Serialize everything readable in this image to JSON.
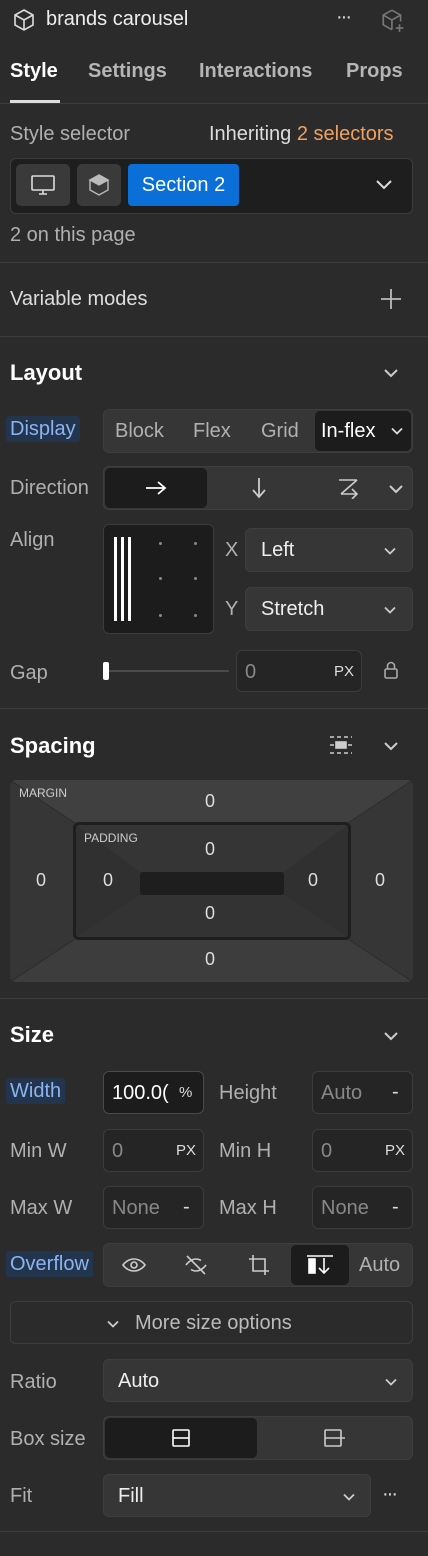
{
  "header": {
    "title": "brands carousel",
    "more_label": "···"
  },
  "tabs": [
    {
      "label": "Style",
      "active": true
    },
    {
      "label": "Settings",
      "active": false
    },
    {
      "label": "Interactions",
      "active": false
    },
    {
      "label": "Props",
      "active": false
    }
  ],
  "selector": {
    "label": "Style selector",
    "inheriting_prefix": "Inheriting",
    "inheriting_count": "2 selectors",
    "chip": "Section 2",
    "on_page": "2 on this page"
  },
  "variable_modes": {
    "label": "Variable modes",
    "add": "+"
  },
  "layout": {
    "title": "Layout",
    "display_label": "Display",
    "display_options": [
      "Block",
      "Flex",
      "Grid",
      "In-flex"
    ],
    "direction_label": "Direction",
    "align_label": "Align",
    "x_label": "X",
    "x_value": "Left",
    "y_label": "Y",
    "y_value": "Stretch",
    "gap_label": "Gap",
    "gap_value": "0",
    "gap_unit": "PX"
  },
  "spacing": {
    "title": "Spacing",
    "margin_label": "MARGIN",
    "padding_label": "PADDING",
    "margin": {
      "top": "0",
      "right": "0",
      "bottom": "0",
      "left": "0"
    },
    "padding": {
      "top": "0",
      "right": "0",
      "bottom": "0",
      "left": "0"
    }
  },
  "size": {
    "title": "Size",
    "width_label": "Width",
    "width_value": "100.0(",
    "width_unit": "%",
    "height_label": "Height",
    "height_value": "Auto",
    "height_unit": "-",
    "min_w_label": "Min W",
    "min_w_value": "0",
    "min_w_unit": "PX",
    "min_h_label": "Min H",
    "min_h_value": "0",
    "min_h_unit": "PX",
    "max_w_label": "Max W",
    "max_w_value": "None",
    "max_w_unit": "-",
    "max_h_label": "Max H",
    "max_h_value": "None",
    "max_h_unit": "-",
    "overflow_label": "Overflow",
    "overflow_auto": "Auto",
    "more_options": "More size options",
    "ratio_label": "Ratio",
    "ratio_value": "Auto",
    "box_size_label": "Box size",
    "fit_label": "Fit",
    "fit_value": "Fill",
    "fit_more": "···"
  },
  "colors": {
    "accent": "#0a6fd6",
    "orange": "#f0a060",
    "highlight": "#8cb4f0"
  }
}
